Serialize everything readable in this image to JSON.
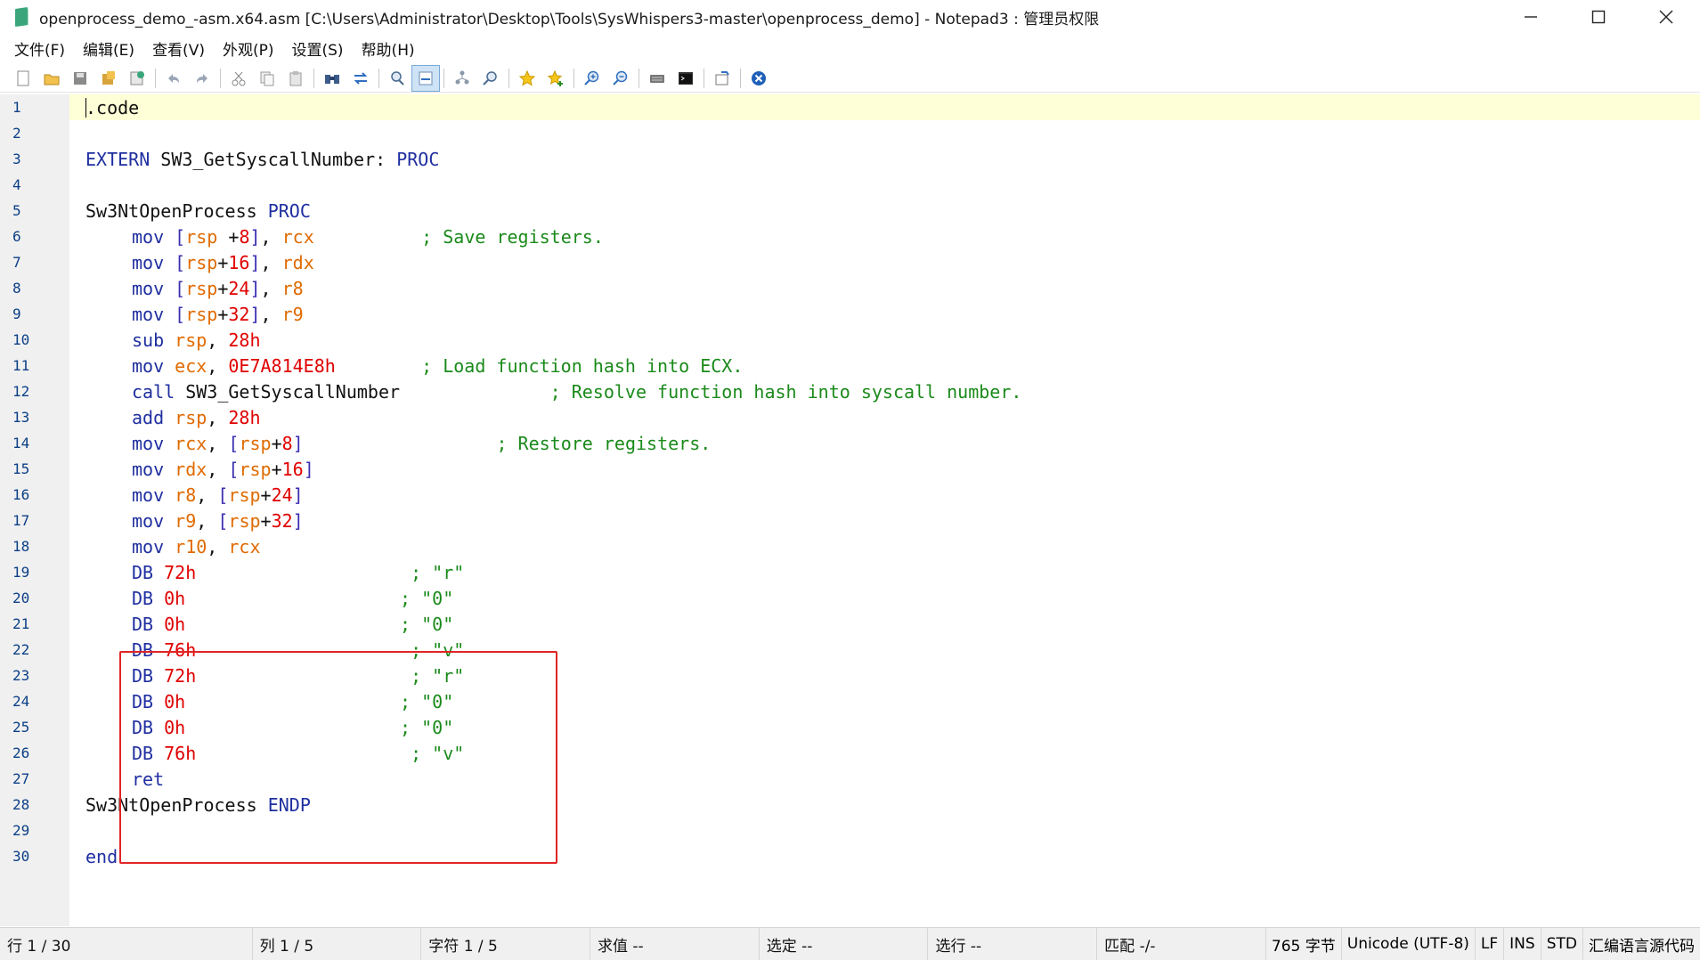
{
  "window": {
    "title": "openprocess_demo_-asm.x64.asm [C:\\Users\\Administrator\\Desktop\\Tools\\SysWhispers3-master\\openprocess_demo] - Notepad3 : 管理员权限"
  },
  "menu": [
    "文件(F)",
    "编辑(E)",
    "查看(V)",
    "外观(P)",
    "设置(S)",
    "帮助(H)"
  ],
  "toolbar": {
    "groups": [
      [
        "new-icon",
        "open-icon",
        "save-icon",
        "save-as-icon",
        "save-copy-icon"
      ],
      [
        "undo-icon",
        "redo-icon"
      ],
      [
        "cut-icon",
        "copy-icon",
        "paste-icon"
      ],
      [
        "find-icon",
        "replace-icon"
      ],
      [
        "find-in-files-icon",
        "word-wrap-icon"
      ],
      [
        "scheme-icon",
        "goto-icon"
      ],
      [
        "favorites-icon",
        "add-favorite-icon"
      ],
      [
        "zoom-in-icon",
        "zoom-out-icon"
      ],
      [
        "keyboard-icon",
        "terminal-icon"
      ],
      [
        "pin-icon"
      ],
      [
        "exit-icon"
      ]
    ],
    "active": "word-wrap-icon"
  },
  "editor": {
    "lines": [
      {
        "n": "1",
        "indent": 0,
        "tokens": [
          [
            "id",
            ".code"
          ]
        ]
      },
      {
        "n": "2",
        "indent": 0,
        "tokens": []
      },
      {
        "n": "3",
        "indent": 0,
        "tokens": [
          [
            "kw",
            "EXTERN"
          ],
          [
            "id",
            " SW3_GetSyscallNumber: "
          ],
          [
            "kw",
            "PROC"
          ]
        ]
      },
      {
        "n": "4",
        "indent": 0,
        "tokens": []
      },
      {
        "n": "5",
        "indent": 0,
        "tokens": [
          [
            "id",
            "Sw3NtOpenProcess "
          ],
          [
            "kw",
            "PROC"
          ]
        ]
      },
      {
        "n": "6",
        "indent": 1,
        "tokens": [
          [
            "kw",
            "mov "
          ],
          [
            "br",
            "["
          ],
          [
            "reg",
            "rsp"
          ],
          [
            "id",
            " +"
          ],
          [
            "num",
            "8"
          ],
          [
            "br",
            "]"
          ],
          [
            "id",
            ", "
          ],
          [
            "reg",
            "rcx"
          ],
          [
            "id",
            "          "
          ],
          [
            "cm",
            "; Save registers."
          ]
        ]
      },
      {
        "n": "7",
        "indent": 1,
        "tokens": [
          [
            "kw",
            "mov "
          ],
          [
            "br",
            "["
          ],
          [
            "reg",
            "rsp"
          ],
          [
            "id",
            "+"
          ],
          [
            "num",
            "16"
          ],
          [
            "br",
            "]"
          ],
          [
            "id",
            ", "
          ],
          [
            "reg",
            "rdx"
          ]
        ]
      },
      {
        "n": "8",
        "indent": 1,
        "tokens": [
          [
            "kw",
            "mov "
          ],
          [
            "br",
            "["
          ],
          [
            "reg",
            "rsp"
          ],
          [
            "id",
            "+"
          ],
          [
            "num",
            "24"
          ],
          [
            "br",
            "]"
          ],
          [
            "id",
            ", "
          ],
          [
            "reg",
            "r8"
          ]
        ]
      },
      {
        "n": "9",
        "indent": 1,
        "tokens": [
          [
            "kw",
            "mov "
          ],
          [
            "br",
            "["
          ],
          [
            "reg",
            "rsp"
          ],
          [
            "id",
            "+"
          ],
          [
            "num",
            "32"
          ],
          [
            "br",
            "]"
          ],
          [
            "id",
            ", "
          ],
          [
            "reg",
            "r9"
          ]
        ]
      },
      {
        "n": "10",
        "indent": 1,
        "tokens": [
          [
            "kw",
            "sub "
          ],
          [
            "reg",
            "rsp"
          ],
          [
            "id",
            ", "
          ],
          [
            "num",
            "28h"
          ]
        ]
      },
      {
        "n": "11",
        "indent": 1,
        "tokens": [
          [
            "kw",
            "mov "
          ],
          [
            "reg",
            "ecx"
          ],
          [
            "id",
            ", "
          ],
          [
            "num",
            "0E7A814E8h"
          ],
          [
            "id",
            "        "
          ],
          [
            "cm",
            "; Load function hash into ECX."
          ]
        ]
      },
      {
        "n": "12",
        "indent": 1,
        "tokens": [
          [
            "kw",
            "call "
          ],
          [
            "id",
            "SW3_GetSyscallNumber"
          ],
          [
            "id",
            "              "
          ],
          [
            "cm",
            "; Resolve function hash into syscall number."
          ]
        ]
      },
      {
        "n": "13",
        "indent": 1,
        "tokens": [
          [
            "kw",
            "add "
          ],
          [
            "reg",
            "rsp"
          ],
          [
            "id",
            ", "
          ],
          [
            "num",
            "28h"
          ]
        ]
      },
      {
        "n": "14",
        "indent": 1,
        "tokens": [
          [
            "kw",
            "mov "
          ],
          [
            "reg",
            "rcx"
          ],
          [
            "id",
            ", "
          ],
          [
            "br",
            "["
          ],
          [
            "reg",
            "rsp"
          ],
          [
            "id",
            "+"
          ],
          [
            "num",
            "8"
          ],
          [
            "br",
            "]"
          ],
          [
            "id",
            "                  "
          ],
          [
            "cm",
            "; Restore registers."
          ]
        ]
      },
      {
        "n": "15",
        "indent": 1,
        "tokens": [
          [
            "kw",
            "mov "
          ],
          [
            "reg",
            "rdx"
          ],
          [
            "id",
            ", "
          ],
          [
            "br",
            "["
          ],
          [
            "reg",
            "rsp"
          ],
          [
            "id",
            "+"
          ],
          [
            "num",
            "16"
          ],
          [
            "br",
            "]"
          ]
        ]
      },
      {
        "n": "16",
        "indent": 1,
        "tokens": [
          [
            "kw",
            "mov "
          ],
          [
            "reg",
            "r8"
          ],
          [
            "id",
            ", "
          ],
          [
            "br",
            "["
          ],
          [
            "reg",
            "rsp"
          ],
          [
            "id",
            "+"
          ],
          [
            "num",
            "24"
          ],
          [
            "br",
            "]"
          ]
        ]
      },
      {
        "n": "17",
        "indent": 1,
        "tokens": [
          [
            "kw",
            "mov "
          ],
          [
            "reg",
            "r9"
          ],
          [
            "id",
            ", "
          ],
          [
            "br",
            "["
          ],
          [
            "reg",
            "rsp"
          ],
          [
            "id",
            "+"
          ],
          [
            "num",
            "32"
          ],
          [
            "br",
            "]"
          ]
        ]
      },
      {
        "n": "18",
        "indent": 1,
        "tokens": [
          [
            "kw",
            "mov "
          ],
          [
            "reg",
            "r10"
          ],
          [
            "id",
            ", "
          ],
          [
            "reg",
            "rcx"
          ]
        ]
      },
      {
        "n": "19",
        "indent": 1,
        "tokens": [
          [
            "kw",
            "DB "
          ],
          [
            "num",
            "72h"
          ],
          [
            "id",
            "                    "
          ],
          [
            "cm",
            "; \"r\""
          ]
        ]
      },
      {
        "n": "20",
        "indent": 1,
        "tokens": [
          [
            "kw",
            "DB "
          ],
          [
            "num",
            "0h"
          ],
          [
            "id",
            "                    "
          ],
          [
            "cm",
            "; \"0\""
          ]
        ]
      },
      {
        "n": "21",
        "indent": 1,
        "tokens": [
          [
            "kw",
            "DB "
          ],
          [
            "num",
            "0h"
          ],
          [
            "id",
            "                    "
          ],
          [
            "cm",
            "; \"0\""
          ]
        ]
      },
      {
        "n": "22",
        "indent": 1,
        "tokens": [
          [
            "kw",
            "DB "
          ],
          [
            "num",
            "76h"
          ],
          [
            "id",
            "                    "
          ],
          [
            "cm",
            "; \"v\""
          ]
        ]
      },
      {
        "n": "23",
        "indent": 1,
        "tokens": [
          [
            "kw",
            "DB "
          ],
          [
            "num",
            "72h"
          ],
          [
            "id",
            "                    "
          ],
          [
            "cm",
            "; \"r\""
          ]
        ]
      },
      {
        "n": "24",
        "indent": 1,
        "tokens": [
          [
            "kw",
            "DB "
          ],
          [
            "num",
            "0h"
          ],
          [
            "id",
            "                    "
          ],
          [
            "cm",
            "; \"0\""
          ]
        ]
      },
      {
        "n": "25",
        "indent": 1,
        "tokens": [
          [
            "kw",
            "DB "
          ],
          [
            "num",
            "0h"
          ],
          [
            "id",
            "                    "
          ],
          [
            "cm",
            "; \"0\""
          ]
        ]
      },
      {
        "n": "26",
        "indent": 1,
        "tokens": [
          [
            "kw",
            "DB "
          ],
          [
            "num",
            "76h"
          ],
          [
            "id",
            "                    "
          ],
          [
            "cm",
            "; \"v\""
          ]
        ]
      },
      {
        "n": "27",
        "indent": 1,
        "tokens": [
          [
            "kw",
            "ret"
          ]
        ]
      },
      {
        "n": "28",
        "indent": 0,
        "tokens": [
          [
            "id",
            "Sw3NtOpenProcess "
          ],
          [
            "kw",
            "ENDP"
          ]
        ]
      },
      {
        "n": "29",
        "indent": 0,
        "tokens": []
      },
      {
        "n": "30",
        "indent": 0,
        "tokens": [
          [
            "kw",
            "end"
          ]
        ]
      }
    ]
  },
  "statusbar": {
    "line": "行  1 / 30",
    "col": "列  1 / 5",
    "char": "字符  1 / 5",
    "eval": "求值  --",
    "sel": "选定  --",
    "sel_lines": "选行  --",
    "match": "匹配  -/-",
    "bytes": "765 字节",
    "encoding": "Unicode (UTF-8)",
    "eol": "LF",
    "ins": "INS",
    "std": "STD",
    "lexer": "汇编语言源代码"
  }
}
